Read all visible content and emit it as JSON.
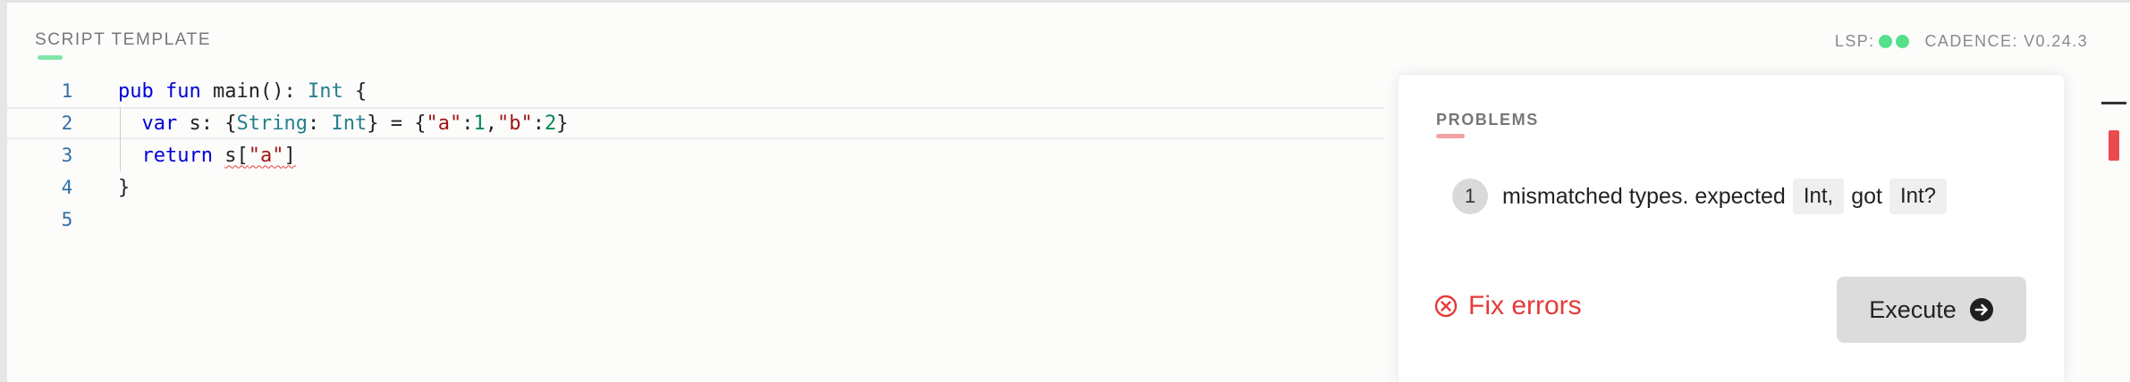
{
  "header": {
    "title": "SCRIPT TEMPLATE",
    "lsp_label": "LSP:",
    "cadence_label": "CADENCE: V0.24.3"
  },
  "editor": {
    "line_numbers": [
      "1",
      "2",
      "3",
      "4",
      "5"
    ],
    "lines": [
      [
        {
          "t": "pub",
          "c": "kw"
        },
        {
          "t": " "
        },
        {
          "t": "fun",
          "c": "kw"
        },
        {
          "t": " main(): "
        },
        {
          "t": "Int",
          "c": "ty"
        },
        {
          "t": " {"
        }
      ],
      [
        {
          "t": "  "
        },
        {
          "t": "var",
          "c": "kw"
        },
        {
          "t": " s: {"
        },
        {
          "t": "String",
          "c": "ty"
        },
        {
          "t": ": "
        },
        {
          "t": "Int",
          "c": "ty"
        },
        {
          "t": "} = {"
        },
        {
          "t": "\"a\"",
          "c": "str"
        },
        {
          "t": ":"
        },
        {
          "t": "1",
          "c": "num"
        },
        {
          "t": ","
        },
        {
          "t": "\"b\"",
          "c": "str"
        },
        {
          "t": ":"
        },
        {
          "t": "2",
          "c": "num"
        },
        {
          "t": "}"
        }
      ],
      [
        {
          "t": "  "
        },
        {
          "t": "return",
          "c": "kw"
        },
        {
          "t": " "
        },
        {
          "t": "s[",
          "c": "sq"
        },
        {
          "t": "\"a\"",
          "c": "str sq"
        },
        {
          "t": "]",
          "c": "sq"
        }
      ],
      [
        {
          "t": "}"
        }
      ],
      []
    ]
  },
  "problems": {
    "title": "PROBLEMS",
    "items": [
      {
        "index": "1",
        "message": "mismatched types. expected",
        "expected": "Int,",
        "got_label": "got",
        "got": "Int?"
      }
    ],
    "fix_label": "Fix errors",
    "execute_label": "Execute"
  },
  "colors": {
    "lsp_status": "#55e08c",
    "error": "#e53a3a",
    "keyword": "#0000d8",
    "type": "#267f8f",
    "string": "#a31515",
    "number": "#098658"
  }
}
